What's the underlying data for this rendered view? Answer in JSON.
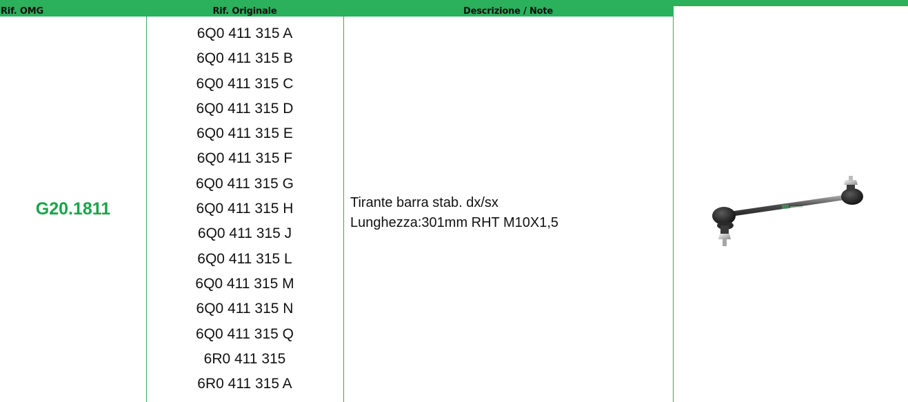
{
  "header": {
    "col_omg": "Rif. OMG",
    "col_original": "Rif. Originale",
    "col_description": "Descrizione / Note"
  },
  "row": {
    "omg_ref": "G20.1811",
    "original_refs": [
      "6Q0 411 315 A",
      "6Q0 411 315 B",
      "6Q0 411 315 C",
      "6Q0 411 315 D",
      "6Q0 411 315 E",
      "6Q0 411 315 F",
      "6Q0 411 315 G",
      "6Q0 411 315 H",
      "6Q0 411 315 J",
      "6Q0 411 315 L",
      "6Q0 411 315 M",
      "6Q0 411 315 N",
      "6Q0 411 315 Q",
      "6R0 411 315",
      "6R0 411 315 A"
    ],
    "description_line1": "Tirante barra stab. dx/sx",
    "description_line2": "Lunghezza:301mm RHT M10X1,5",
    "image": "stabilizer-link-photo"
  },
  "colors": {
    "accent": "#2bb05b",
    "omg_text": "#1aa34a"
  }
}
